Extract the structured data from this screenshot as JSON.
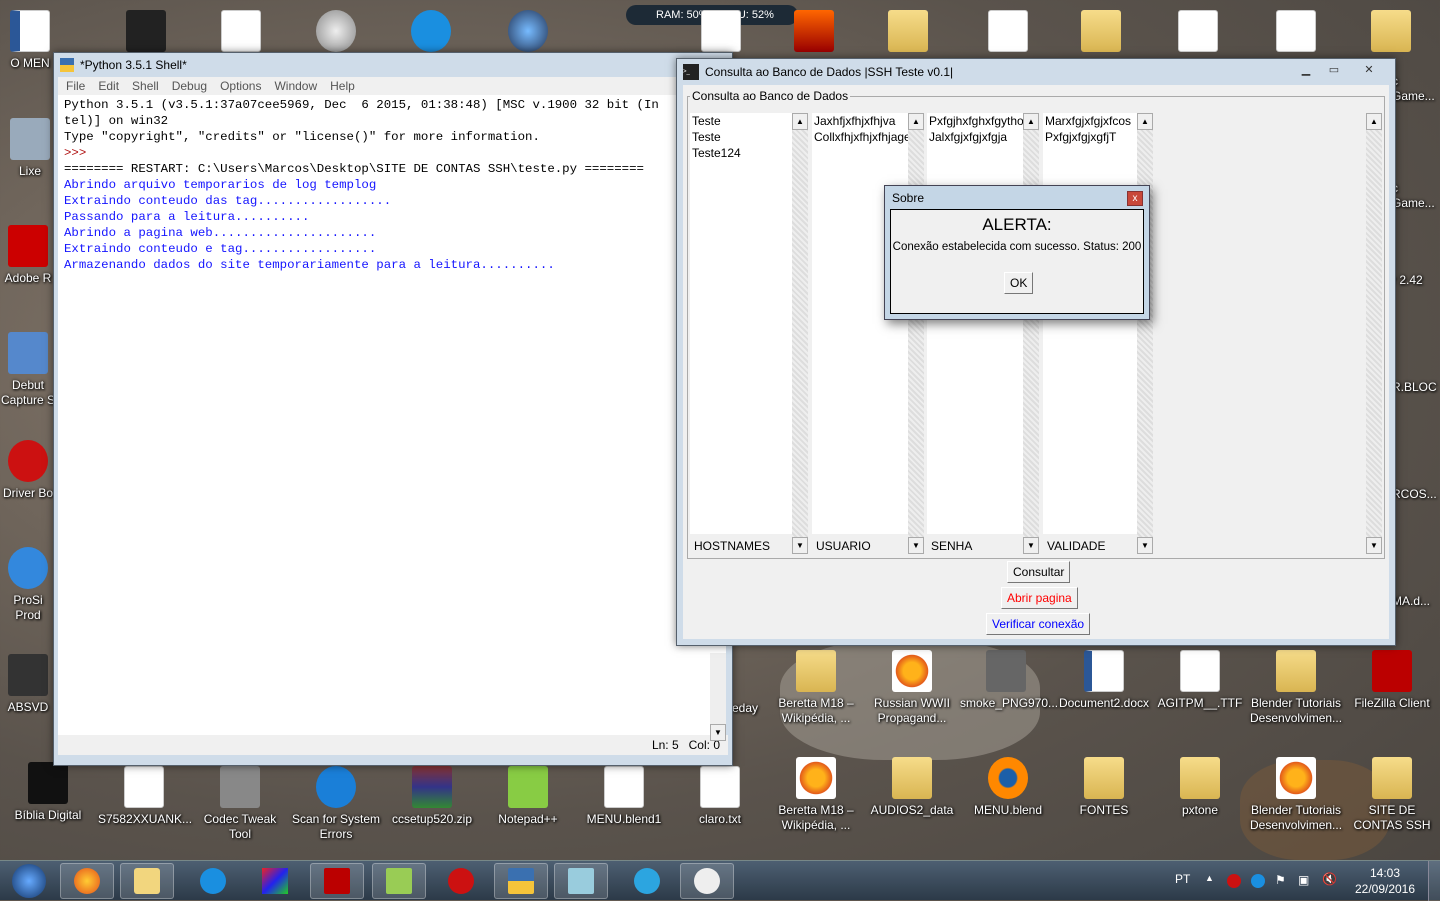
{
  "widget": {
    "ram": "RAM: 50%",
    "cpu": "CPU: 52%"
  },
  "desktop_icons": {
    "left": [
      "O MEN",
      "Lixe",
      "Adobe R",
      "Debut Capture S",
      "Driver Bo",
      "ProSi Prod",
      "ABSVD",
      "Bíblia Digital"
    ],
    "right": [
      "c Game...",
      "c Game...",
      "r 2.42",
      "R.BLOC",
      "RCOS...",
      "MA.d..."
    ],
    "row1": [
      "eday",
      "Beretta M18 – Wikipédia, ...",
      "Russian WWII Propagand...",
      "smoke_PNG970...",
      "Document2.docx",
      "AGITPM__.TTF",
      "Blender Tutoriais Desenvolvimen...",
      "FileZilla Client"
    ],
    "row2": [
      "S7582XXUANK...",
      "Codec Tweak Tool",
      "Scan for System Errors",
      "ccsetup520.zip",
      "Notepad++",
      "MENU.blend1",
      "claro.txt",
      "Beretta M18 – Wikipédia, ...",
      "AUDIOS2_data",
      "MENU.blend",
      "FONTES",
      "pxtone",
      "Blender Tutoriais Desenvolvimen...",
      "SITE DE CONTAS SSH"
    ]
  },
  "shell": {
    "title": "*Python 3.5.1 Shell*",
    "menu": [
      "File",
      "Edit",
      "Shell",
      "Debug",
      "Options",
      "Window",
      "Help"
    ],
    "lines": [
      {
        "t": "Python 3.5.1 (v3.5.1:37a07cee5969, Dec  6 2015, 01:38:48) [MSC v.1900 32 bit (In",
        "c": ""
      },
      {
        "t": "tel)] on win32",
        "c": ""
      },
      {
        "t": "Type \"copyright\", \"credits\" or \"license()\" for more information.",
        "c": ""
      },
      {
        "t": ">>> ",
        "c": "red"
      },
      {
        "t": "======== RESTART: C:\\Users\\Marcos\\Desktop\\SITE DE CONTAS SSH\\teste.py ========",
        "c": ""
      },
      {
        "t": "Abrindo arquivo temporarios de log templog",
        "c": "blue"
      },
      {
        "t": "Extraindo conteudo das tag..................",
        "c": "blue"
      },
      {
        "t": "Passando para a leitura..........",
        "c": "blue"
      },
      {
        "t": "Abrindo a pagina web......................",
        "c": "blue"
      },
      {
        "t": "Extraindo conteudo e tag..................",
        "c": "blue"
      },
      {
        "t": "Armazenando dados do site temporariamente para a leitura..........",
        "c": "blue"
      }
    ],
    "status": {
      "ln": "Ln: 5",
      "col": "Col: 0"
    }
  },
  "app": {
    "title": "Consulta ao Banco de Dados |SSH Teste v0.1|",
    "group": "Consulta ao Banco de Dados",
    "columns": [
      {
        "label": "HOSTNAMES",
        "items": [
          "Teste",
          "Teste",
          "Teste124"
        ]
      },
      {
        "label": "USUARIO",
        "items": [
          "Jaxhfjxfhjxfhjva",
          "Collxfhjxfhjxfhjagebr"
        ]
      },
      {
        "label": "SENHA",
        "items": [
          "Pxfgjhxfghxfgython",
          "Jalxfgjxfgjxfgja"
        ]
      },
      {
        "label": "VALIDADE",
        "items": [
          "Marxfgjxfgjxfcos",
          "PxfgjxfgjxgfjT"
        ]
      }
    ],
    "buttons": {
      "consultar": "Consultar",
      "abrir": "Abrir pagina",
      "verificar": "Verificar conexão"
    },
    "colors": {
      "abrir": "#ff0000",
      "verificar": "#0000ff"
    }
  },
  "dialog": {
    "title": "Sobre",
    "heading": "ALERTA:",
    "message": "Conexão estabelecida com sucesso. Status: 200",
    "ok": "OK"
  },
  "tray": {
    "lang": "PT",
    "time": "14:03",
    "date": "22/09/2016"
  }
}
